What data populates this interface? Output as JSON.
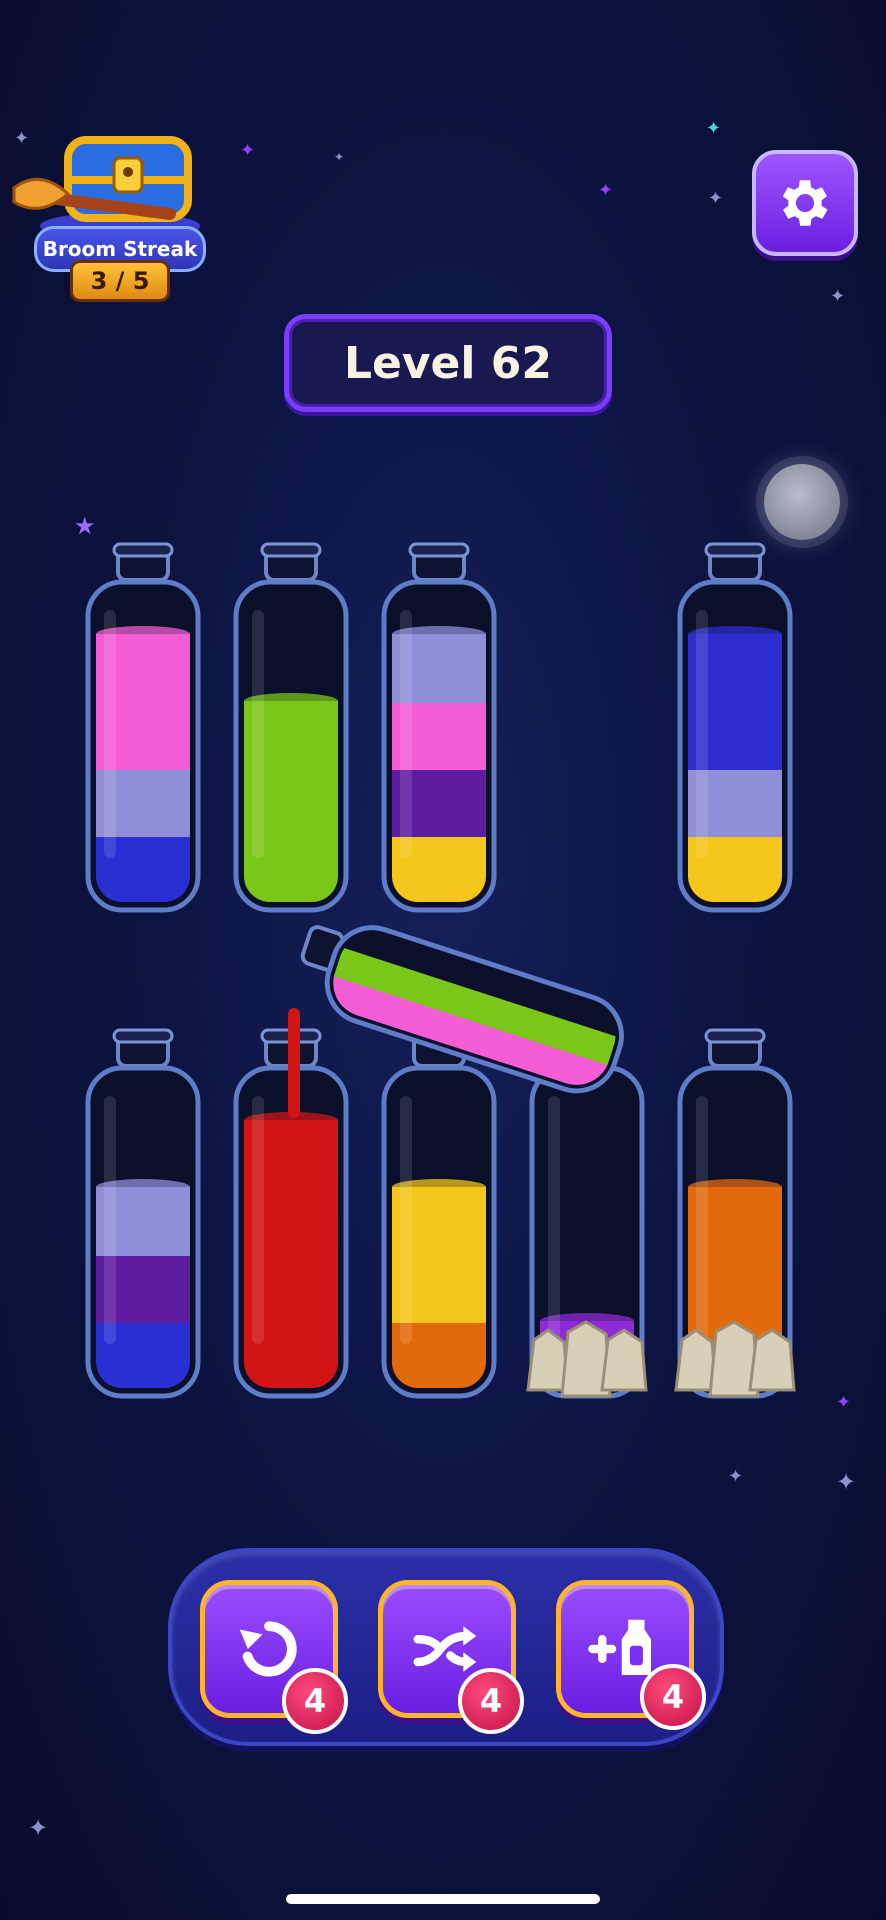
{
  "streak": {
    "label": "Broom Streak",
    "count": "3 / 5"
  },
  "level": {
    "title": "Level 62"
  },
  "settings": {
    "icon": "gear-icon"
  },
  "colors": {
    "pink": "#f45dd6",
    "lavender": "#8f8fd9",
    "blue": "#2a2fd4",
    "green": "#7ac71a",
    "purple": "#5e1ca0",
    "yellow": "#f4c51a",
    "navy": "#2d2ecf",
    "red": "#d11414",
    "orange": "#e36a0c",
    "violet": "#8e2ad6"
  },
  "bottles_top": [
    {
      "layers": [
        "blue",
        "lavender",
        "pink",
        "pink"
      ]
    },
    {
      "layers": [
        "green",
        "green",
        "green"
      ]
    },
    {
      "layers": [
        "yellow",
        "purple",
        "pink",
        "lavender"
      ]
    },
    {
      "layers": [
        "yellow",
        "lavender",
        "navy",
        "navy"
      ]
    }
  ],
  "bottles_bottom": [
    {
      "layers": [
        "blue",
        "purple",
        "lavender"
      ]
    },
    {
      "layers": [
        "red",
        "red",
        "red",
        "red"
      ]
    },
    {
      "layers": [
        "orange",
        "yellow",
        "yellow"
      ]
    },
    {
      "layers": [
        "violet"
      ],
      "locked": true
    },
    {
      "layers": [
        "orange",
        "orange",
        "orange"
      ],
      "locked": true
    }
  ],
  "pouring_bottle": {
    "layers": [
      "pink",
      "green"
    ]
  },
  "powerups": [
    {
      "name": "undo",
      "icon": "undo-icon",
      "count": "4"
    },
    {
      "name": "shuffle",
      "icon": "shuffle-icon",
      "count": "4"
    },
    {
      "name": "add-bottle",
      "icon": "add-bottle-icon",
      "count": "4"
    }
  ]
}
